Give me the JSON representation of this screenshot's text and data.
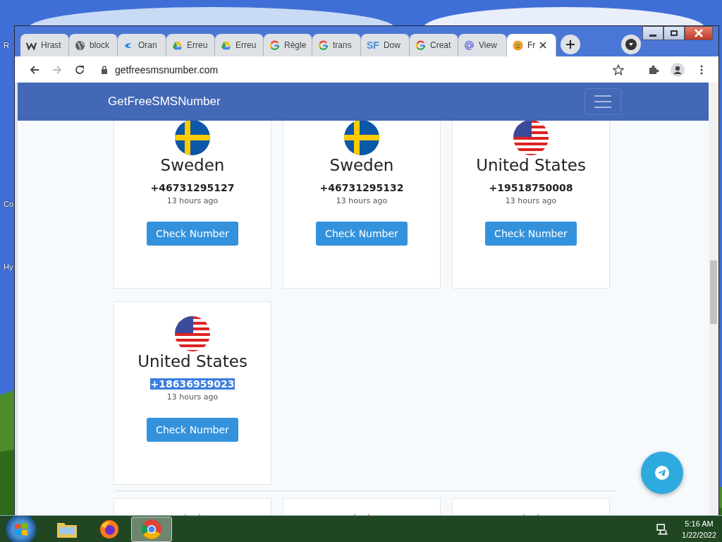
{
  "desktop_icons": [
    {
      "label": "R"
    },
    {
      "label": "Co"
    },
    {
      "label": "Hy"
    }
  ],
  "tabs": [
    {
      "label": "Hrast",
      "selected": false
    },
    {
      "label": "block",
      "selected": false
    },
    {
      "label": "Oran",
      "selected": false
    },
    {
      "label": "Erreu",
      "selected": false
    },
    {
      "label": "Erreu",
      "selected": false
    },
    {
      "label": "Règle",
      "selected": false
    },
    {
      "label": "trans",
      "selected": false
    },
    {
      "label": "Dow",
      "icon_text": "SF",
      "selected": false
    },
    {
      "label": "Creat",
      "selected": false
    },
    {
      "label": "View",
      "selected": false
    },
    {
      "label": "Fr",
      "selected": true
    }
  ],
  "address_bar": {
    "url": "getfreesmsnumber.com"
  },
  "navbar": {
    "brand": "GetFreeSMSNumber"
  },
  "cards": [
    {
      "country": "Sweden",
      "number": "+46731295127",
      "time": "13 hours ago",
      "button": "Check Number",
      "highlighted": false
    },
    {
      "country": "Sweden",
      "number": "+46731295132",
      "time": "13 hours ago",
      "button": "Check Number",
      "highlighted": false
    },
    {
      "country": "United States",
      "number": "+19518750008",
      "time": "13 hours ago",
      "button": "Check Number",
      "highlighted": false
    },
    {
      "country": "United States",
      "number": "+18636959023",
      "time": "13 hours ago",
      "button": "Check Number",
      "highlighted": true
    }
  ],
  "taskbar": {
    "apps": [
      {
        "selected": false
      },
      {
        "selected": false
      },
      {
        "selected": true
      }
    ],
    "time": "5:16 AM",
    "date": "1/22/2022"
  }
}
